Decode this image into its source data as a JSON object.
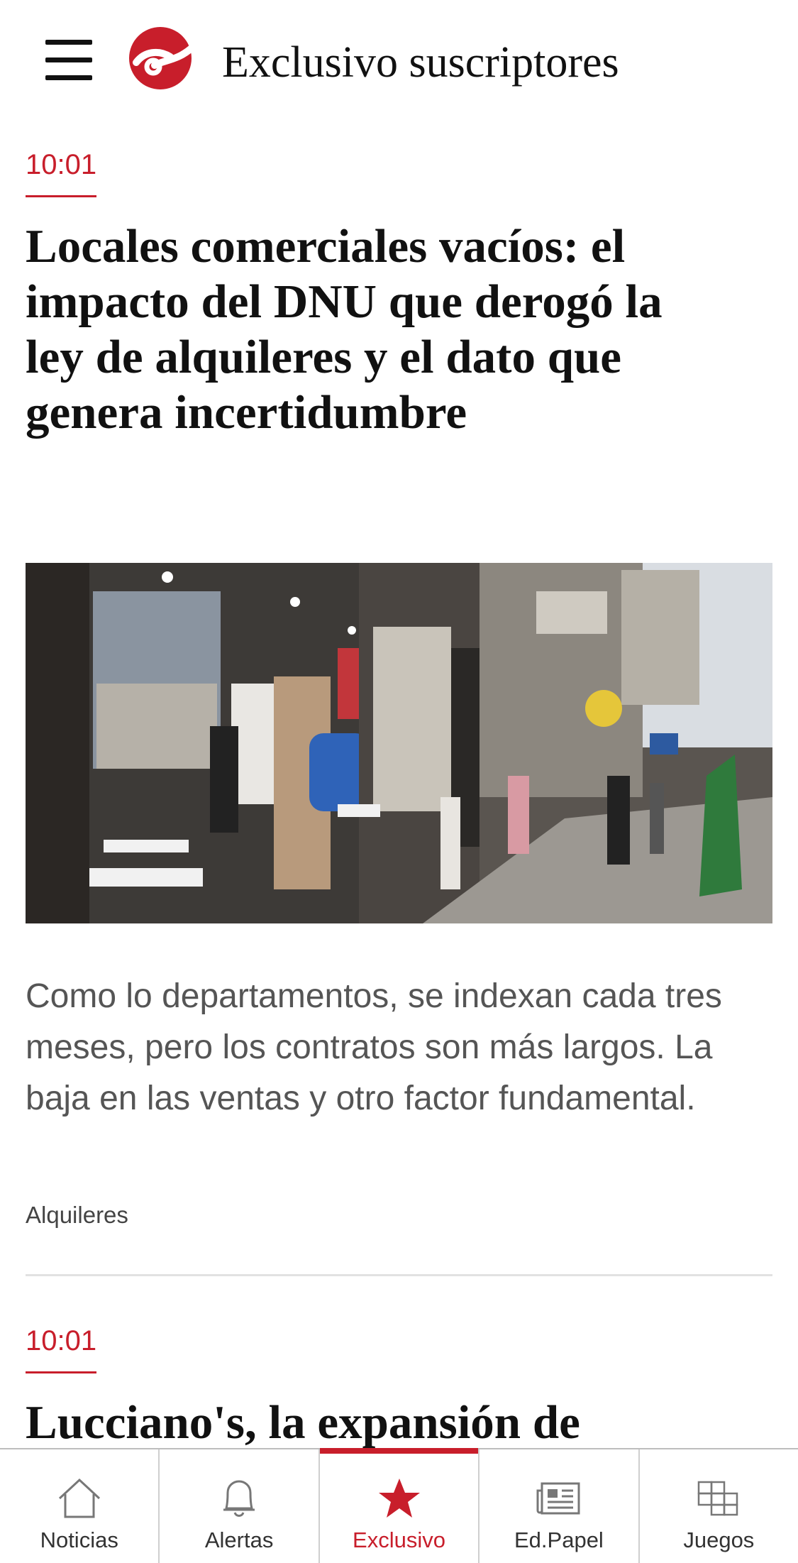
{
  "header": {
    "title": "Exclusivo suscriptores",
    "logo_icon": "clarin-logo-icon",
    "menu_icon": "hamburger-menu-icon"
  },
  "colors": {
    "accent": "#c81e2b",
    "text": "#111111",
    "summary_text": "#555555"
  },
  "articles": [
    {
      "time": "10:01",
      "headline": "Locales comerciales vacíos: el impacto del DNU que derogó la ley de alquileres y el dato que genera incertidumbre",
      "image_alt": "Locales comerciales en una calle peatonal",
      "summary": "Como lo departamentos, se indexan cada tres meses, pero los contratos son más largos. La baja en las ventas y otro factor fundamental.",
      "section": "Alquileres"
    },
    {
      "time": "10:01",
      "headline": "Lucciano's, la expansión de"
    }
  ],
  "tabbar": {
    "items": [
      {
        "label": "Noticias",
        "icon": "home-icon",
        "active": false
      },
      {
        "label": "Alertas",
        "icon": "bell-icon",
        "active": false
      },
      {
        "label": "Exclusivo",
        "icon": "star-icon",
        "active": true
      },
      {
        "label": "Ed.Papel",
        "icon": "newspaper-icon",
        "active": false
      },
      {
        "label": "Juegos",
        "icon": "games-grid-icon",
        "active": false
      }
    ]
  }
}
